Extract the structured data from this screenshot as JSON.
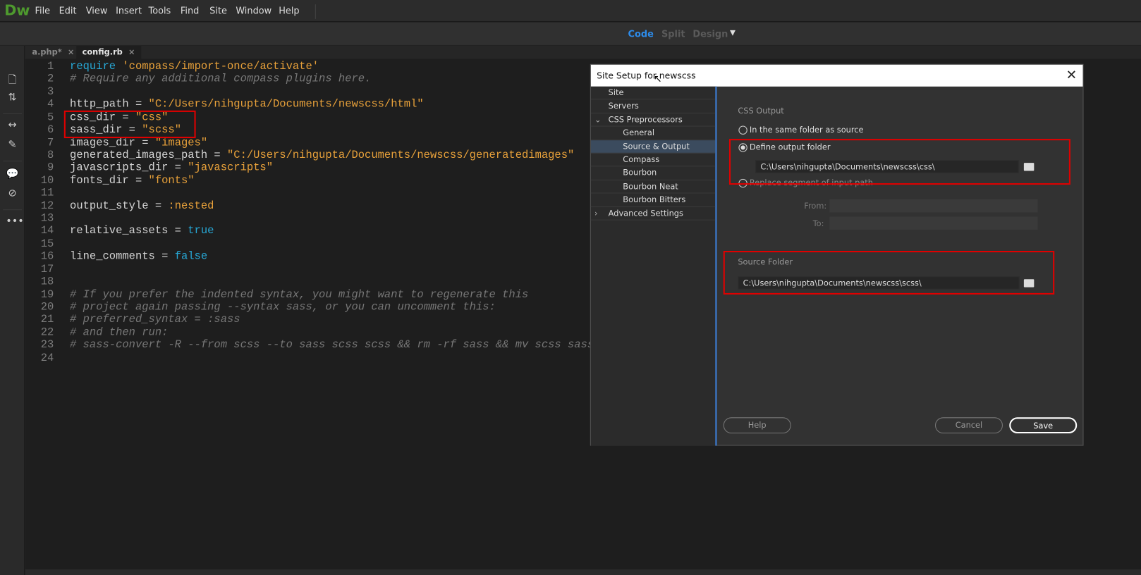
{
  "app": {
    "logo": "Dw"
  },
  "menu": [
    "File",
    "Edit",
    "View",
    "Insert",
    "Tools",
    "Find",
    "Site",
    "Window",
    "Help"
  ],
  "view_modes": {
    "code": "Code",
    "split": "Split",
    "design": "Design"
  },
  "tabs": [
    {
      "label": "a.php*"
    },
    {
      "label": "config.rb"
    }
  ],
  "close_glyph": "×",
  "code_lines": [
    [
      [
        "kw",
        "require"
      ],
      [
        "tx",
        " "
      ],
      [
        "str",
        "'compass/import-once/activate'"
      ]
    ],
    [
      [
        "cm",
        "# Require any additional compass plugins here."
      ]
    ],
    [],
    [
      [
        "tx",
        "http_path = "
      ],
      [
        "str",
        "\"C:/Users/nihgupta/Documents/newscss/html\""
      ]
    ],
    [
      [
        "tx",
        "css_dir = "
      ],
      [
        "str",
        "\"css\""
      ]
    ],
    [
      [
        "tx",
        "sass_dir = "
      ],
      [
        "str",
        "\"scss\""
      ]
    ],
    [
      [
        "tx",
        "images_dir = "
      ],
      [
        "str",
        "\"images\""
      ]
    ],
    [
      [
        "tx",
        "generated_images_path = "
      ],
      [
        "str",
        "\"C:/Users/nihgupta/Documents/newscss/generatedimages\""
      ]
    ],
    [
      [
        "tx",
        "javascripts_dir = "
      ],
      [
        "str",
        "\"javascripts\""
      ]
    ],
    [
      [
        "tx",
        "fonts_dir = "
      ],
      [
        "str",
        "\"fonts\""
      ]
    ],
    [],
    [
      [
        "tx",
        "output_style = "
      ],
      [
        "str",
        ":nested"
      ]
    ],
    [],
    [
      [
        "tx",
        "relative_assets = "
      ],
      [
        "kw",
        "true"
      ]
    ],
    [],
    [
      [
        "tx",
        "line_comments = "
      ],
      [
        "kw",
        "false"
      ]
    ],
    [],
    [],
    [
      [
        "cm",
        "# If you prefer the indented syntax, you might want to regenerate this"
      ]
    ],
    [
      [
        "cm",
        "# project again passing --syntax sass, or you can uncomment this:"
      ]
    ],
    [
      [
        "cm",
        "# preferred_syntax = :sass"
      ]
    ],
    [
      [
        "cm",
        "# and then run:"
      ]
    ],
    [
      [
        "cm",
        "# sass-convert -R --from scss --to sass scss scss && rm -rf sass && mv scss sass"
      ]
    ],
    []
  ],
  "dialog": {
    "title": "Site Setup for newscss",
    "close": "✕",
    "nav": [
      {
        "label": "Site",
        "level": 0
      },
      {
        "label": "Servers",
        "level": 0
      },
      {
        "label": "CSS Preprocessors",
        "level": 0,
        "arrow": "⌄"
      },
      {
        "label": "General",
        "level": 1
      },
      {
        "label": "Source & Output",
        "level": 1,
        "selected": true
      },
      {
        "label": "Compass",
        "level": 1
      },
      {
        "label": "Bourbon",
        "level": 1
      },
      {
        "label": "Bourbon Neat",
        "level": 1
      },
      {
        "label": "Bourbon Bitters",
        "level": 1
      },
      {
        "label": "Advanced Settings",
        "level": 0,
        "arrow": "›"
      }
    ],
    "css_output_label": "CSS Output",
    "opt_same": "In the same folder as source",
    "opt_define": "Define output folder",
    "output_path": "C:\\Users\\nihgupta\\Documents\\newscss\\css\\",
    "opt_replace": "Replace segment of input path",
    "from_label": "From:",
    "to_label": "To:",
    "source_label": "Source Folder",
    "source_path": "C:\\Users\\nihgupta\\Documents\\newscss\\scss\\",
    "help": "Help",
    "cancel": "Cancel",
    "save": "Save"
  }
}
